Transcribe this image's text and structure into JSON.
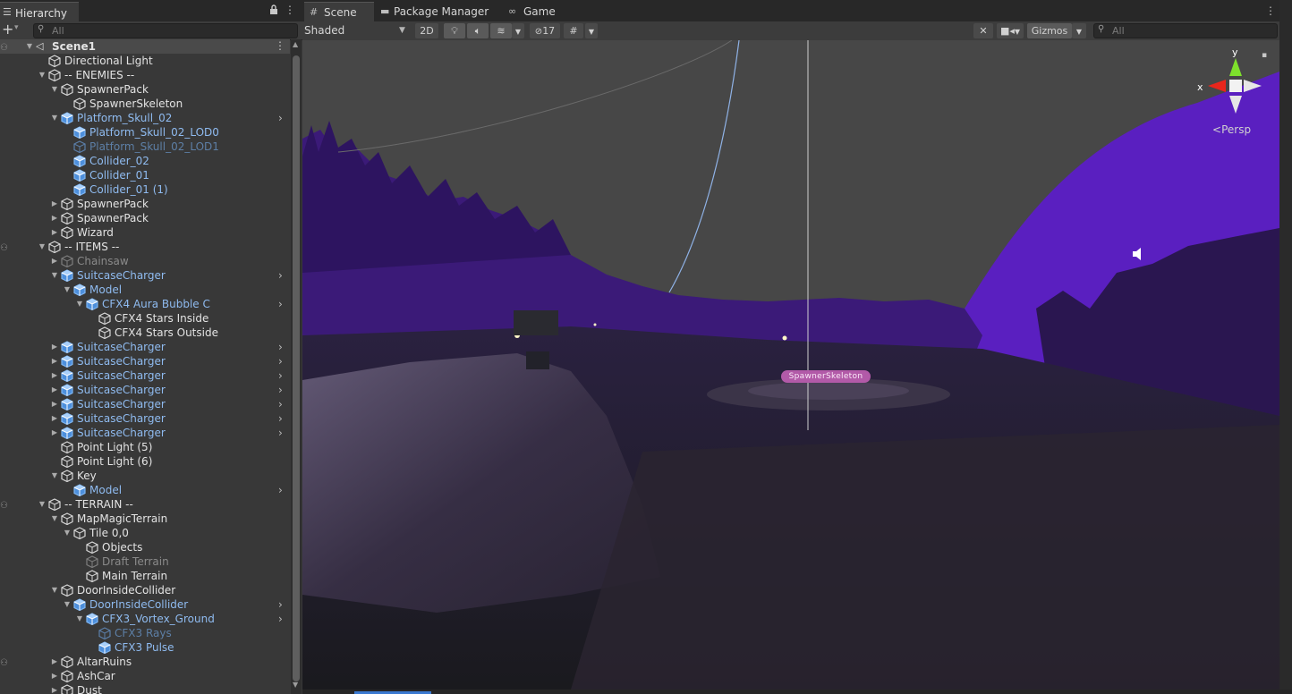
{
  "hierarchy": {
    "tab_title": "Hierarchy",
    "search_placeholder": "All",
    "rows": [
      {
        "label": "Scene1"
      },
      {
        "label": "Directional Light"
      },
      {
        "label": "-- ENEMIES --"
      },
      {
        "label": "SpawnerPack"
      },
      {
        "label": "SpawnerSkeleton"
      },
      {
        "label": "Platform_Skull_02"
      },
      {
        "label": "Platform_Skull_02_LOD0"
      },
      {
        "label": "Platform_Skull_02_LOD1"
      },
      {
        "label": "Collider_02"
      },
      {
        "label": "Collider_01"
      },
      {
        "label": "Collider_01 (1)"
      },
      {
        "label": "SpawnerPack"
      },
      {
        "label": "SpawnerPack"
      },
      {
        "label": "Wizard"
      },
      {
        "label": "-- ITEMS --"
      },
      {
        "label": "Chainsaw"
      },
      {
        "label": "SuitcaseCharger"
      },
      {
        "label": "Model"
      },
      {
        "label": "CFX4 Aura Bubble C"
      },
      {
        "label": "CFX4 Stars Inside"
      },
      {
        "label": "CFX4 Stars Outside"
      },
      {
        "label": "SuitcaseCharger"
      },
      {
        "label": "SuitcaseCharger"
      },
      {
        "label": "SuitcaseCharger"
      },
      {
        "label": "SuitcaseCharger"
      },
      {
        "label": "SuitcaseCharger"
      },
      {
        "label": "SuitcaseCharger"
      },
      {
        "label": "SuitcaseCharger"
      },
      {
        "label": "Point Light (5)"
      },
      {
        "label": "Point Light (6)"
      },
      {
        "label": "Key"
      },
      {
        "label": "Model"
      },
      {
        "label": "-- TERRAIN --"
      },
      {
        "label": "MapMagicTerrain"
      },
      {
        "label": "Tile 0,0"
      },
      {
        "label": "Objects"
      },
      {
        "label": "Draft Terrain"
      },
      {
        "label": "Main Terrain"
      },
      {
        "label": "DoorInsideCollider"
      },
      {
        "label": "DoorInsideCollider"
      },
      {
        "label": "CFX3_Vortex_Ground"
      },
      {
        "label": "CFX3 Rays"
      },
      {
        "label": "CFX3 Pulse"
      },
      {
        "label": "AltarRuins"
      },
      {
        "label": "AshCar"
      },
      {
        "label": "Dust"
      }
    ]
  },
  "tabs": {
    "scene": "Scene",
    "package_manager": "Package Manager",
    "game": "Game"
  },
  "toolbar": {
    "shading_mode": "Shaded",
    "two_d": "2D",
    "hidden_count": "17",
    "gizmos": "Gizmos",
    "search_placeholder": "All"
  },
  "viewport": {
    "gizmo_x": "x",
    "gizmo_y": "y",
    "projection": "Persp",
    "object_label": "SpawnerSkeleton",
    "colors": {
      "sky": "#474747",
      "hill": "#5a1fc0",
      "ground": "#1b1626",
      "gizmo_x": "#e8261c",
      "gizmo_y": "#7ee12c"
    }
  }
}
